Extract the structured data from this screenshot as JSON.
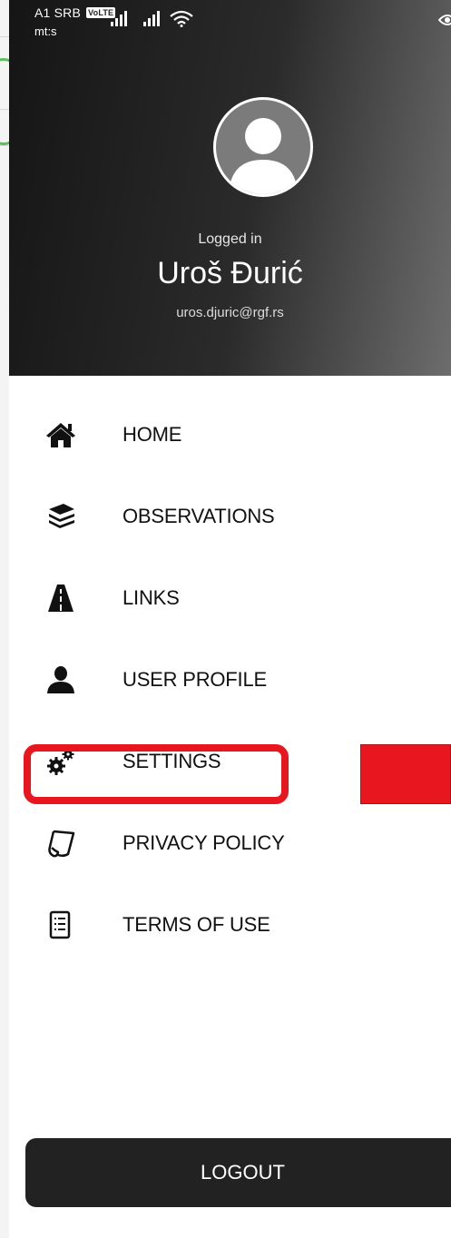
{
  "status_bar": {
    "carrier": "A1 SRB",
    "volte_badge": "VoLTE",
    "carrier_secondary": "mt:s"
  },
  "profile": {
    "status": "Logged in",
    "name": "Uroš Đurić",
    "email": "uros.djuric@rgf.rs"
  },
  "menu": {
    "items": [
      {
        "label": "HOME",
        "icon": "home-icon"
      },
      {
        "label": "OBSERVATIONS",
        "icon": "layers-icon"
      },
      {
        "label": "LINKS",
        "icon": "road-icon"
      },
      {
        "label": "USER PROFILE",
        "icon": "user-icon"
      },
      {
        "label": "SETTINGS",
        "icon": "gears-icon"
      },
      {
        "label": "PRIVACY POLICY",
        "icon": "scroll-icon"
      },
      {
        "label": "TERMS OF USE",
        "icon": "document-list-icon"
      }
    ]
  },
  "logout_label": "LOGOUT",
  "colors": {
    "highlight": "#e8171f",
    "header_dark": "#151515",
    "button_dark": "#222222"
  }
}
